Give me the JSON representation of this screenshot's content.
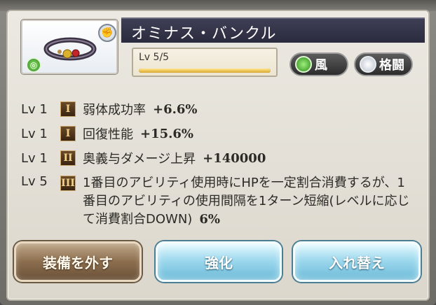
{
  "item": {
    "name": "オミナス・バンクル",
    "level_label": "Lv 5/5",
    "level_progress": 1.0,
    "element_label": "風",
    "type_label": "格闘"
  },
  "skills": [
    {
      "lv": "Lv 1",
      "rank": "I",
      "name": "弱体成功率",
      "value": "+6.6%"
    },
    {
      "lv": "Lv 1",
      "rank": "I",
      "name": "回復性能",
      "value": "+15.6%"
    },
    {
      "lv": "Lv 1",
      "rank": "II",
      "name": "奥義与ダメージ上昇",
      "value": "+140000"
    },
    {
      "lv": "Lv 5",
      "rank": "III",
      "name": "1番目のアビリティ使用時にHPを一定割合消費するが、1番目のアビリティの使用間隔を1ターン短縮(レベルに応じて消費割合DOWN)",
      "value": "6%"
    }
  ],
  "buttons": {
    "unequip": "装備を外す",
    "upgrade": "強化",
    "swap": "入れ替え"
  },
  "colors": {
    "title_bar": "#2f3045",
    "wind_element": "#3f9a2a",
    "roman_badge": "#4a3018",
    "unequip_button": "#8c6e4e",
    "action_button": "#9fd9ee"
  }
}
